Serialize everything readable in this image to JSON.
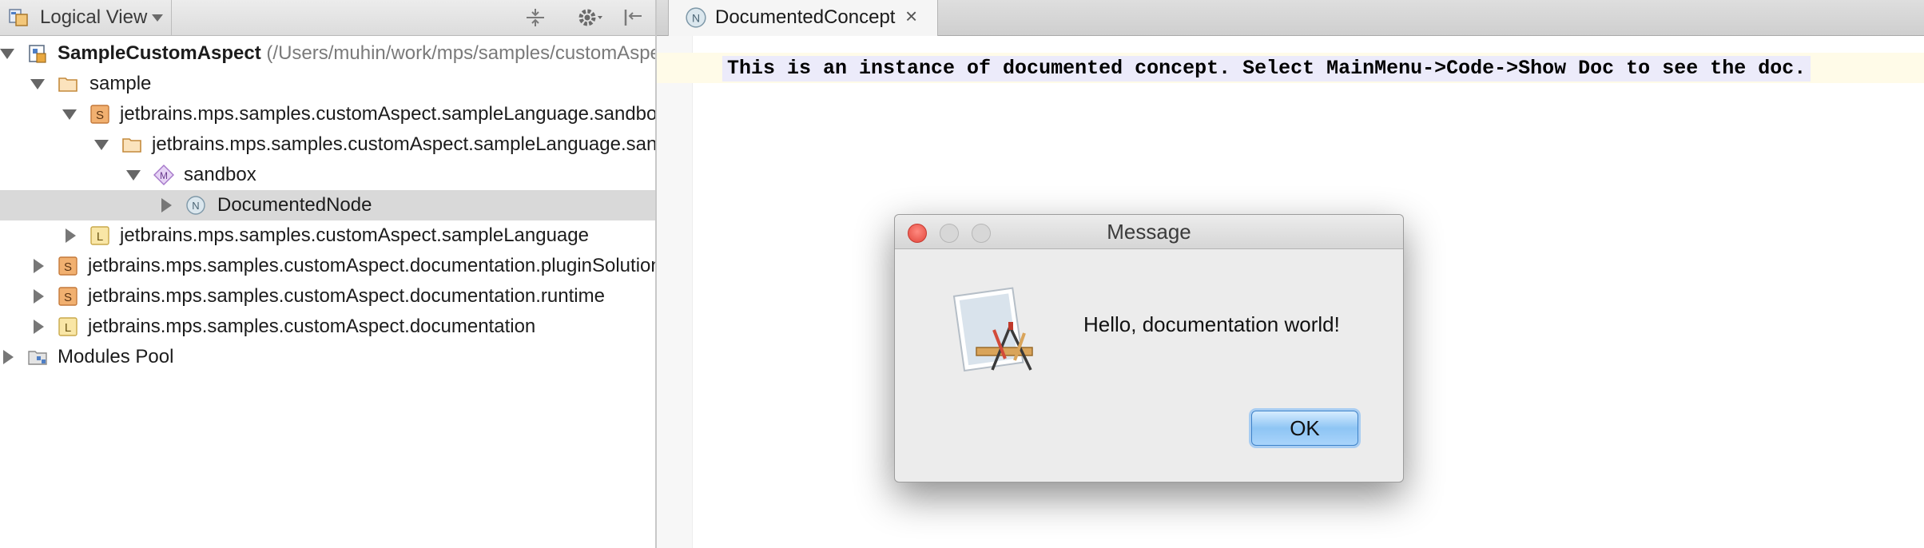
{
  "project_view": {
    "selector_label": "Logical View",
    "tree": [
      {
        "label": "SampleCustomAspect",
        "path": "(/Users/muhin/work/mps/samples/customAspect)",
        "icon": "project-icon"
      },
      {
        "label": "sample",
        "icon": "folder-icon"
      },
      {
        "label": "jetbrains.mps.samples.customAspect.sampleLanguage.sandbox",
        "icon": "solution-icon"
      },
      {
        "label": "jetbrains.mps.samples.customAspect.sampleLanguage.sandbox",
        "icon": "folder-icon"
      },
      {
        "label": "sandbox",
        "icon": "model-icon"
      },
      {
        "label": "DocumentedNode",
        "icon": "node-icon"
      },
      {
        "label": "jetbrains.mps.samples.customAspect.sampleLanguage",
        "icon": "language-icon"
      },
      {
        "label": "jetbrains.mps.samples.customAspect.documentation.pluginSolution",
        "icon": "solution-icon"
      },
      {
        "label": "jetbrains.mps.samples.customAspect.documentation.runtime",
        "icon": "solution-icon"
      },
      {
        "label": "jetbrains.mps.samples.customAspect.documentation",
        "icon": "language-icon"
      },
      {
        "label": "Modules Pool",
        "icon": "modules-pool-icon"
      }
    ]
  },
  "editor": {
    "tab_label": "DocumentedConcept",
    "tab_close": "×",
    "code_line": "This is an instance of documented concept. Select MainMenu->Code->Show Doc to see the doc."
  },
  "dialog": {
    "title": "Message",
    "message": "Hello, documentation world!",
    "ok_label": "OK"
  },
  "icons": {
    "node_badge": "N",
    "solution_badge": "S",
    "language_badge": "L",
    "model_badge": "M"
  },
  "colors": {
    "selection_row": "#d9d9d9",
    "code_highlight": "#ecebfa",
    "ok_button": "#8ec5f4",
    "close_light": "#e2463c"
  }
}
